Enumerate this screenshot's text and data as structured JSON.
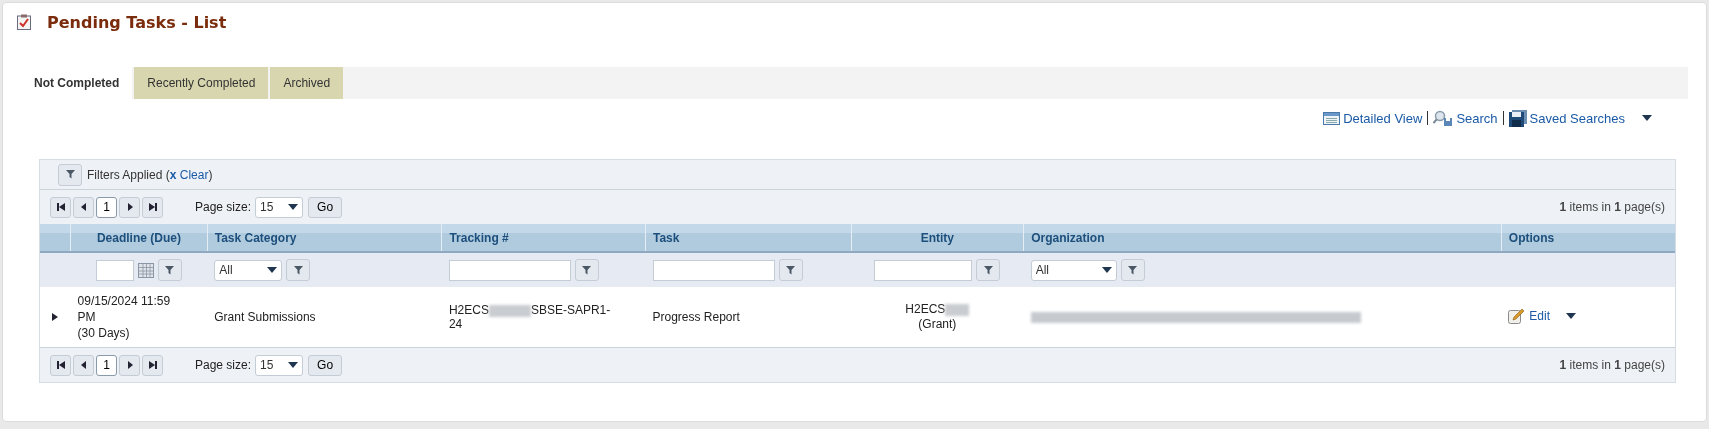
{
  "page": {
    "title": "Pending Tasks - List"
  },
  "tabs": [
    {
      "label": "Not Completed",
      "selected": true
    },
    {
      "label": "Recently Completed",
      "selected": false
    },
    {
      "label": "Archived",
      "selected": false
    }
  ],
  "toolbar": [
    {
      "kind": "detailed-view",
      "label": "Detailed View"
    },
    {
      "kind": "search",
      "label": "Search"
    },
    {
      "kind": "saved-searches",
      "label": "Saved Searches"
    }
  ],
  "filters_bar": {
    "label": "Filters Applied (",
    "link": "**x** Clear",
    "end": ")"
  },
  "pagers": [
    {
      "page": "1",
      "page_size_label": "Page size:",
      "page_size": "15",
      "go": "Go",
      "summary": "**1** items in **1** page(s)"
    },
    {
      "page": "1",
      "page_size_label": "Page size:",
      "page_size": "15",
      "go": "Go",
      "summary": "**1** items in **1** page(s)"
    }
  ],
  "columns": [
    {
      "label": "Deadline (Due)",
      "kind": "date",
      "centered": true
    },
    {
      "label": "Task Category",
      "kind": "select",
      "value": "All",
      "centered": false
    },
    {
      "label": "Tracking #",
      "kind": "text",
      "centered": false
    },
    {
      "label": "Task",
      "kind": "text",
      "centered": false
    },
    {
      "label": "Entity",
      "kind": "text",
      "centered": true
    },
    {
      "label": "Organization",
      "kind": "select",
      "value": "All",
      "centered": false
    },
    {
      "label": "Options",
      "kind": "none",
      "centered": false
    }
  ],
  "rows": [
    {
      "expanded": false,
      "deadline": "09/15/2024 11:59 PM",
      "deadline_note": "(30 Days)",
      "category": "Grant Submissions",
      "tracking_prefix": "H2ECS",
      "tracking_suffix": "SBSE-SAPR1-",
      "tracking_line2": "24",
      "task": "Progress Report",
      "entity": "H2ECS",
      "entity_note": "(Grant)",
      "organization_redacted": true,
      "option": "Edit"
    }
  ]
}
